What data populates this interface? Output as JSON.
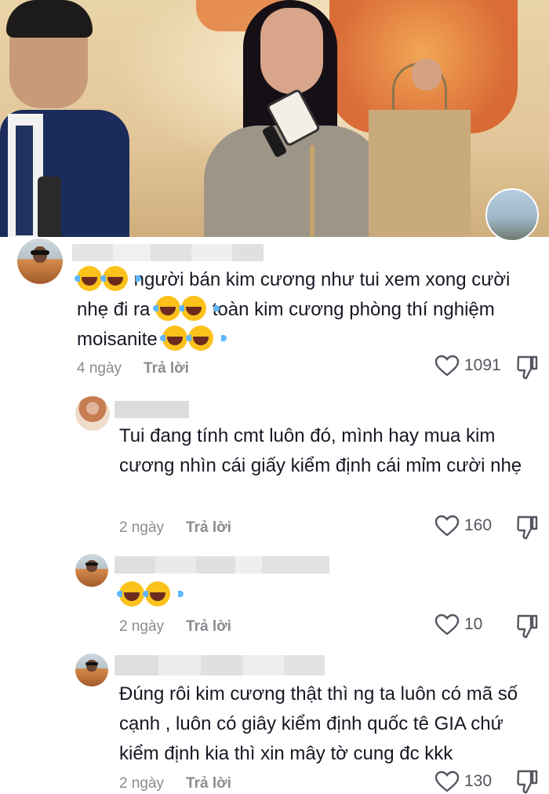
{
  "comments": [
    {
      "text_parts": [
        "",
        "người bán kim cương như tui xem xong cười nhẹ đi ra",
        "toàn kim cương phòng thí nghiệm moisanite"
      ],
      "age": "4 ngày",
      "reply_label": "Trả lời",
      "likes": "1091"
    },
    {
      "text": "Tui đang tính cmt luôn đó, mình hay mua kim cương nhìn cái giấy kiểm định cái mỉm cười nhẹ",
      "age": "2 ngày",
      "reply_label": "Trả lời",
      "likes": "160"
    },
    {
      "text": "",
      "age": "2 ngày",
      "reply_label": "Trả lời",
      "likes": "10"
    },
    {
      "text": "Đúng rôi kim cương thật thì ng ta luôn có mã số cạnh , luôn có giây kiểm định quốc tê GIA chứ kiểm định kia thì xin mây tờ cung đc kkk",
      "age": "2 ngày",
      "reply_label": "Trả lời",
      "likes": "130"
    }
  ],
  "icons": {
    "like": "heart-outline-icon",
    "dislike": "thumbs-down-icon",
    "emoji": "face-with-tears-of-joy-emoji"
  },
  "colors": {
    "text": "#161823",
    "meta": "#8a8b91",
    "redaction": "#dcdcdc"
  }
}
